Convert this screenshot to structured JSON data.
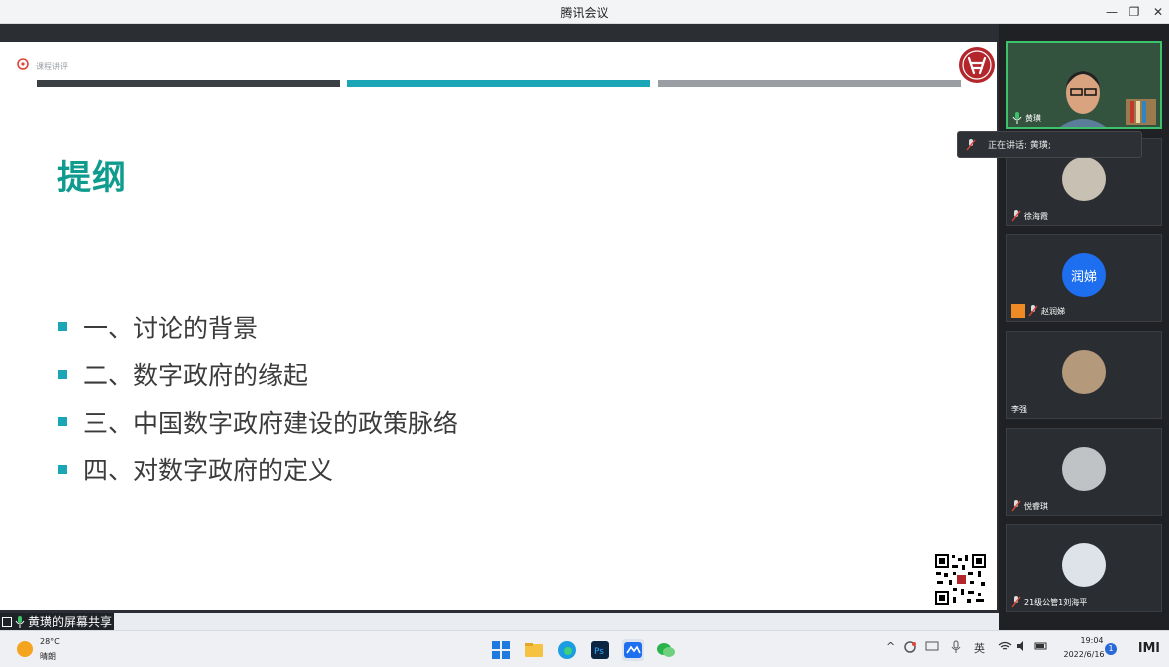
{
  "window": {
    "title": "腾讯会议",
    "minimize": "—",
    "restore": "❐",
    "close": "✕"
  },
  "slide": {
    "watermark_text": "课程讲评",
    "title": "提纲",
    "bullets": [
      "一、讨论的背景",
      "二、数字政府的缘起",
      "三、中国数字政府建设的政策脉络",
      "四、对数字政府的定义"
    ],
    "colors": {
      "title": "#0f9c8f",
      "bullet": "#1aa6b7",
      "bar1": "#3b4044",
      "bar2": "#1aa6b7",
      "bar3": "#9a9ea2"
    }
  },
  "share_label": "黄璜的屏幕共享",
  "speaking_popup": "正在讲话: 黄璜;",
  "participants": [
    {
      "name": "黄璜",
      "avatar": ""
    },
    {
      "name": "徐海霞",
      "avatar": ""
    },
    {
      "name": "赵润娣",
      "avatar": "润娣"
    },
    {
      "name": "李强",
      "avatar": ""
    },
    {
      "name": "悦睿琪",
      "avatar": ""
    },
    {
      "name": "21级公管1刘海平",
      "avatar": ""
    }
  ],
  "taskbar": {
    "temperature": "28°C",
    "weather": "晴朗",
    "ime": "英",
    "time": "19:04",
    "date": "2022/6/16",
    "notification_count": "1",
    "end_label": "lΜl"
  }
}
